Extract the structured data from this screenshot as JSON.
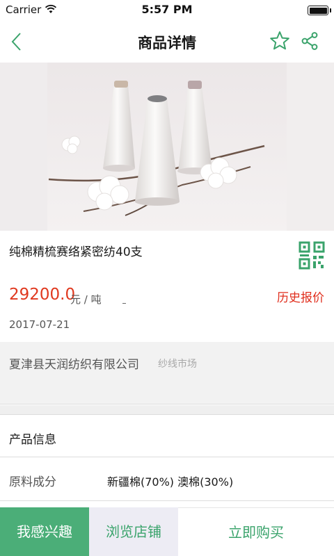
{
  "status_bar": {
    "carrier": "Carrier",
    "time": "5:57 PM",
    "battery_level": 1.0
  },
  "nav": {
    "title": "商品详情",
    "back_icon": "chevron-left-icon",
    "favorite_icon": "star-outline-icon",
    "share_icon": "share-icon",
    "accent_color": "#3aa36b"
  },
  "product": {
    "name": "纯棉精梳赛络紧密纺40支",
    "price": "29200.0",
    "price_unit": "元 / 吨",
    "history_price_label": "历史报价",
    "date": "2017-07-21",
    "qr_icon": "qr-code-icon",
    "price_color": "#e0391f"
  },
  "company": {
    "name": "夏津县天润纺织有限公司",
    "tag": "纱线市场"
  },
  "info": {
    "header": "产品信息",
    "rows": [
      {
        "label": "原料成分",
        "value": "新疆棉(70%)  澳棉(30%)"
      }
    ]
  },
  "bottom_bar": {
    "interest_label": "我感兴趣",
    "browse_label": "浏览店铺",
    "buy_label": "立即购买"
  }
}
